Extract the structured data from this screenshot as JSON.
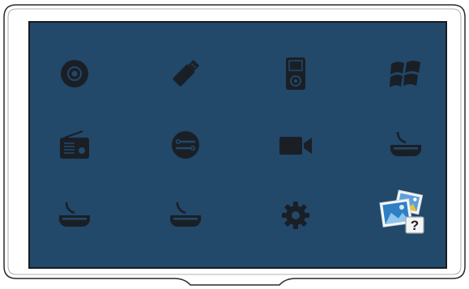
{
  "screen": {
    "background": "#22486a",
    "icon_color": "#1a1f26",
    "sources": [
      {
        "icon": "disc-icon"
      },
      {
        "icon": "usb-drive-icon"
      },
      {
        "icon": "media-player-icon"
      },
      {
        "icon": "windows-logo-icon"
      },
      {
        "icon": "radio-icon"
      },
      {
        "icon": "network-share-icon"
      },
      {
        "icon": "video-camera-icon"
      },
      {
        "icon": "hdmi-input-icon"
      },
      {
        "icon": "hdmi-input-icon"
      },
      {
        "icon": "hdmi-input-icon"
      },
      {
        "icon": "settings-gear-icon"
      },
      {
        "icon": "unknown-photo-icon"
      }
    ]
  }
}
